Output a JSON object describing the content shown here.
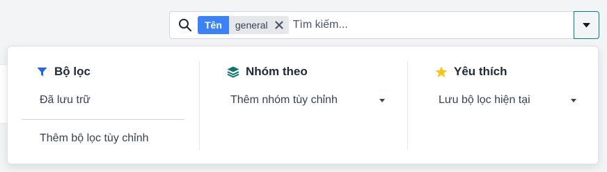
{
  "search": {
    "facet_label": "Tên",
    "facet_value": "general",
    "placeholder": "Tìm kiếm..."
  },
  "panel": {
    "filters": {
      "title": "Bộ lọc",
      "icon": "filter-icon",
      "items": [
        "Đã lưu trữ"
      ],
      "add_custom": "Thêm bộ lọc tùy chỉnh"
    },
    "group_by": {
      "title": "Nhóm theo",
      "icon": "layers-icon",
      "add_custom": "Thêm nhóm tùy chỉnh"
    },
    "favorites": {
      "title": "Yêu thích",
      "icon": "star-icon",
      "save_current": "Lưu bộ lọc hiện tại"
    }
  },
  "colors": {
    "facet_blue": "#3b82f6",
    "filter_icon": "#2563eb",
    "group_icon": "#0f766e",
    "star_icon": "#f5c518",
    "toggle_border": "#017e84"
  }
}
